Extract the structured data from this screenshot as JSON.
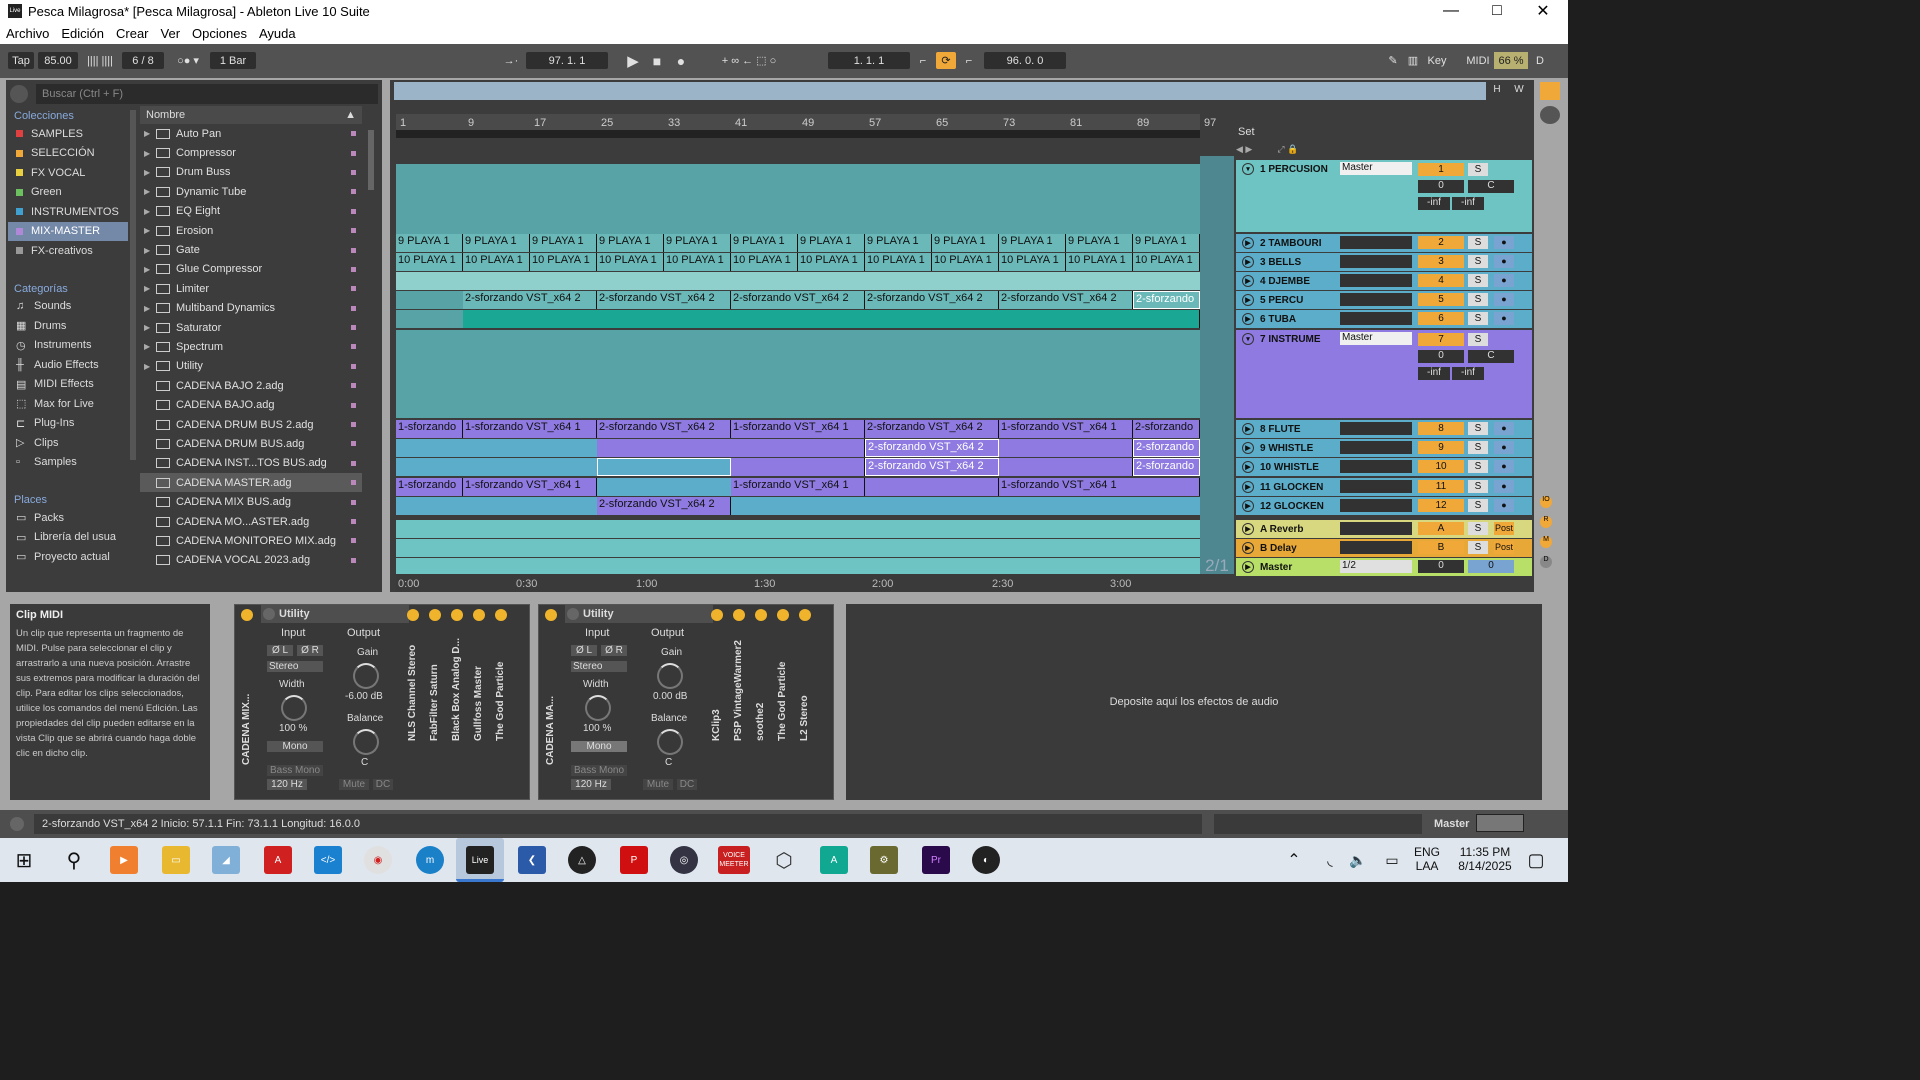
{
  "window": {
    "title": "Pesca Milagrosa* [Pesca Milagrosa] - Ableton Live 10 Suite",
    "app_icon": "Live"
  },
  "menu": [
    "Archivo",
    "Edición",
    "Crear",
    "Ver",
    "Opciones",
    "Ayuda"
  ],
  "transport": {
    "tap": "Tap",
    "tempo": "85.00",
    "meter": "6 / 8",
    "quantize": "1 Bar",
    "position": "97.  1.  1",
    "loop_start": "1.  1.  1",
    "loop_len": "96.  0.  0",
    "key": "Key",
    "midi": "MIDI",
    "cpu": "66 %",
    "d": "D"
  },
  "browser": {
    "search_placeholder": "Buscar (Ctrl + F)",
    "collections_header": "Colecciones",
    "collections": [
      {
        "label": "SAMPLES",
        "color": "#e04040"
      },
      {
        "label": "SELECCIÓN",
        "color": "#f0a838"
      },
      {
        "label": "FX VOCAL",
        "color": "#e8d040"
      },
      {
        "label": "Green",
        "color": "#6cc060"
      },
      {
        "label": "INSTRUMENTOS",
        "color": "#40a0d0"
      },
      {
        "label": "MIX-MASTER",
        "color": "#b088d8"
      },
      {
        "label": "FX-creativos",
        "color": "#999999"
      }
    ],
    "categories_header": "Categorías",
    "categories": [
      "Sounds",
      "Drums",
      "Instruments",
      "Audio Effects",
      "MIDI Effects",
      "Max for Live",
      "Plug-Ins",
      "Clips",
      "Samples"
    ],
    "places_header": "Places",
    "places": [
      "Packs",
      "Librería del usua",
      "Proyecto actual"
    ],
    "names_header": "Nombre",
    "folders": [
      "Auto Pan",
      "Compressor",
      "Drum Buss",
      "Dynamic Tube",
      "EQ Eight",
      "Erosion",
      "Gate",
      "Glue Compressor",
      "Limiter",
      "Multiband Dynamics",
      "Saturator",
      "Spectrum",
      "Utility"
    ],
    "files": [
      "CADENA BAJO 2.adg",
      "CADENA BAJO.adg",
      "CADENA DRUM BUS 2.adg",
      "CADENA DRUM BUS.adg",
      "CADENA INST...TOS BUS.adg",
      "CADENA MASTER.adg",
      "CADENA MIX BUS.adg",
      "CADENA MO...ASTER.adg",
      "CADENA MONITOREO MIX.adg",
      "CADENA VOCAL 2023.adg"
    ]
  },
  "ruler": [
    "1",
    "9",
    "17",
    "25",
    "33",
    "41",
    "49",
    "57",
    "65",
    "73",
    "81",
    "89",
    "97"
  ],
  "time_ruler": [
    "0:00",
    "0:30",
    "1:00",
    "1:30",
    "2:00",
    "2:30",
    "3:00"
  ],
  "set_label": "Set",
  "page_count": "2/1",
  "clips": {
    "playa9": "9 PLAYA 1",
    "playa10": "10 PLAYA 1",
    "sfz2": "2-sforzando VST_x64 2",
    "sfz2short": "2-sforzando",
    "sfz1": "1-sforzando VST_x64 1",
    "sfz1short": "1-sforzando"
  },
  "tracks": [
    {
      "name": "1 PERCUSION",
      "num": "1",
      "out": "Master",
      "vol": "0",
      "pan": "C",
      "inf": "-inf"
    },
    {
      "name": "2 TAMBOURI",
      "num": "2"
    },
    {
      "name": "3 BELLS",
      "num": "3"
    },
    {
      "name": "4 DJEMBE",
      "num": "4"
    },
    {
      "name": "5 PERCU",
      "num": "5"
    },
    {
      "name": "6 TUBA",
      "num": "6"
    },
    {
      "name": "7 INSTRUME",
      "num": "7",
      "out": "Master",
      "vol": "0",
      "pan": "C",
      "inf": "-inf"
    },
    {
      "name": "8 FLUTE",
      "num": "8"
    },
    {
      "name": "9 WHISTLE",
      "num": "9"
    },
    {
      "name": "10 WHISTLE",
      "num": "10"
    },
    {
      "name": "11 GLOCKEN",
      "num": "11"
    },
    {
      "name": "12 GLOCKEN",
      "num": "12"
    },
    {
      "name": "A Reverb",
      "num": "A",
      "post": "Post"
    },
    {
      "name": "B Delay",
      "num": "B",
      "post": "Post"
    },
    {
      "name": "Master",
      "num": "0",
      "out": "1/2",
      "vol": "0"
    }
  ],
  "solo": "S",
  "info": {
    "title": "Clip MIDI",
    "text": "Un clip que representa un fragmento de MIDI. Pulse para seleccionar el clip y arrastrarlo a una nueva posición. Arrastre sus extremos para modificar la duración del clip. Para editar los clips seleccionados, utilice los comandos del menú Edición. Las propiedades del clip pueden editarse en la vista Clip que se abrirá cuando haga doble clic en dicho clip."
  },
  "devices": [
    {
      "rack": "CADENA MIX...",
      "title": "Utility",
      "input": "Input",
      "output": "Output",
      "gain": "Gain",
      "gain_val": "-6.00 dB",
      "width": "Width",
      "width_val": "100 %",
      "balance": "Balance",
      "bal_val": "C",
      "mode": "Stereo",
      "mono": "Mono",
      "bassmono": "Bass Mono",
      "hz": "120 Hz",
      "mute": "Mute",
      "dc": "DC",
      "phase_l": "Ø L",
      "phase_r": "Ø R",
      "plugins": [
        "NLS Channel Stereo",
        "FabFilter Saturn",
        "Black Box Analog D...",
        "Gullfoss Master",
        "The God Particle"
      ]
    },
    {
      "rack": "CADENA MA...",
      "title": "Utility",
      "input": "Input",
      "output": "Output",
      "gain": "Gain",
      "gain_val": "0.00 dB",
      "width": "Width",
      "width_val": "100 %",
      "balance": "Balance",
      "bal_val": "C",
      "mode": "Stereo",
      "mono": "Mono",
      "bassmono": "Bass Mono",
      "hz": "120 Hz",
      "mute": "Mute",
      "dc": "DC",
      "phase_l": "Ø L",
      "phase_r": "Ø R",
      "plugins": [
        "KClip3",
        "PSP VintageWarmer2",
        "soothe2",
        "The God Particle",
        "L2 Stereo"
      ]
    }
  ],
  "dropzone": "Deposite aquí los efectos de audio",
  "status": {
    "text": "2-sforzando VST_x64 2  Inicio: 57.1.1  Fin: 73.1.1  Longitud: 16.0.0",
    "master": "Master"
  },
  "taskbar": {
    "lang1": "ENG",
    "lang2": "LAA",
    "time": "11:35 PM",
    "date": "8/14/2025",
    "voicemeeter": "VOICE MEETER",
    "live": "Live"
  },
  "colors": {
    "teal": "#6bb8b8",
    "teal_dark": "#58a3a6",
    "purple": "#8e7ae0",
    "blue_clip": "#5cadc9",
    "orange": "#f0a838"
  }
}
